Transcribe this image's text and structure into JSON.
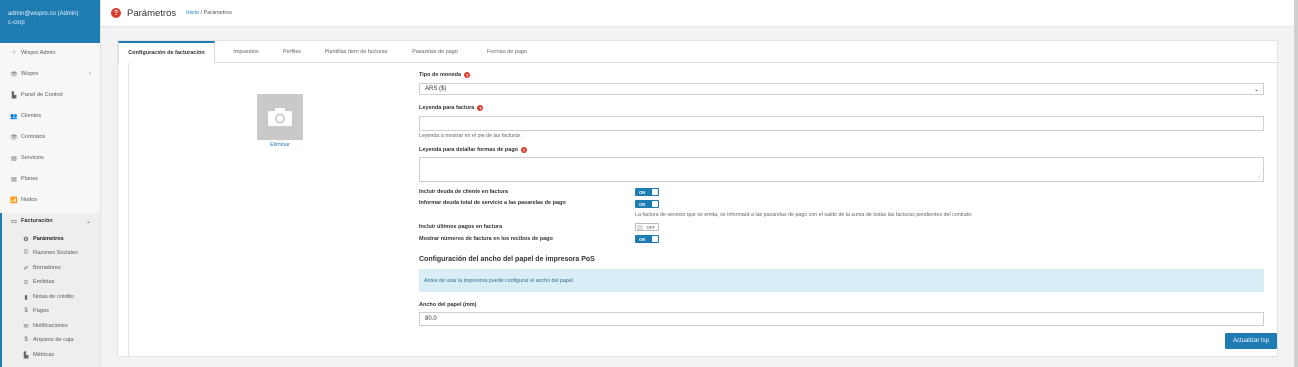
{
  "sidebar": {
    "user_line1": "admin@wispro.co (Admin)",
    "user_line2": "c-corp",
    "items": [
      {
        "label": "Wispro Admin",
        "icon": "○"
      },
      {
        "label": "Wispro",
        "icon": "👁"
      },
      {
        "label": "Panel de Control",
        "icon": "▙"
      },
      {
        "label": "Clientes",
        "icon": "👥"
      },
      {
        "label": "Contratos",
        "icon": "👁"
      },
      {
        "label": "Servicios",
        "icon": "▤"
      },
      {
        "label": "Planes",
        "icon": "▤"
      },
      {
        "label": "Nodos",
        "icon": "📶"
      },
      {
        "label": "Facturación",
        "icon": "▭"
      }
    ],
    "chevron_left": "‹",
    "chevron_down": "⌄",
    "subitems": [
      {
        "label": "Parámetros",
        "icon": "⚙"
      },
      {
        "label": "Razones Sociales",
        "icon": "©"
      },
      {
        "label": "Borradores",
        "icon": "✐"
      },
      {
        "label": "Emitidas",
        "icon": "⊙"
      },
      {
        "label": "Notas de crédito",
        "icon": "▮"
      },
      {
        "label": "Pagos",
        "icon": "$"
      },
      {
        "label": "Notificaciones",
        "icon": "✉"
      },
      {
        "label": "Arqueos de caja",
        "icon": "$"
      },
      {
        "label": "Métricas",
        "icon": "▙"
      }
    ]
  },
  "header": {
    "title": "Parámetros",
    "breadcrumb_link": "Inicio",
    "breadcrumb_sep": " / ",
    "breadcrumb_current": "Parámetros"
  },
  "tabs": [
    "Configuración de facturación",
    "Impuestos",
    "Perfiles",
    "Plantillas ítem de facturas",
    "Pasarelas de pago",
    "Formas de pago"
  ],
  "form": {
    "delete_label": "Eliminar",
    "currency_label": "Tipo de moneda",
    "currency_value": "ARS ($)",
    "invoice_legend_label": "Leyenda para factura",
    "invoice_legend_hint": "Leyenda a mostrar en el pie de las facturas",
    "payment_legend_label": "Leyenda para detallar formas de pago",
    "toggles": [
      {
        "label": "Incluir deuda de cliente en factura",
        "state": "ON"
      },
      {
        "label": "Informar deuda total de servicio a las pasarelas de pago",
        "state": "ON"
      },
      {
        "label": "Incluir últimos pagos en factura",
        "state": "OFF"
      },
      {
        "label": "Mostrar números de factura en los recibos de pago",
        "state": "ON"
      }
    ],
    "gateway_hint": "La factura de servicio que se emita, se informará a las pasarelas de pago con el saldo de la suma de todas las facturas pendientes del contrato.",
    "printer_section_title": "Configuración del ancho del papel de impresora PoS",
    "printer_info": "Antes de usar la impresora puede configurar el ancho del papel.",
    "paper_width_label": "Ancho del papel (mm)",
    "paper_width_value": "80.0",
    "submit_label": "Actualizar tsp"
  },
  "colors": {
    "accent": "#1f7cb3",
    "help": "#d93a2b",
    "info_bg": "#d9edf7"
  }
}
